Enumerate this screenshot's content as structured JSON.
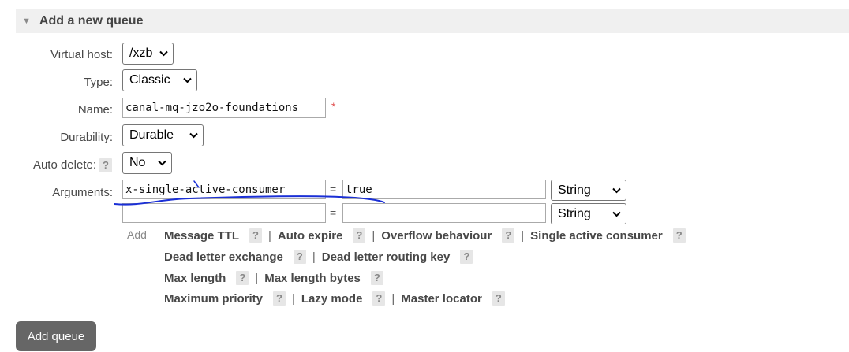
{
  "section": {
    "title": "Add a new queue"
  },
  "fields": {
    "vhost": {
      "label": "Virtual host:",
      "value": "/xzb"
    },
    "type": {
      "label": "Type:",
      "value": "Classic"
    },
    "name": {
      "label": "Name:",
      "value": "canal-mq-jzo2o-foundations",
      "required_mark": "*"
    },
    "durability": {
      "label": "Durability:",
      "value": "Durable"
    },
    "auto_delete": {
      "label": "Auto delete:",
      "help": "?",
      "value": "No"
    },
    "arguments": {
      "label": "Arguments:",
      "rows": [
        {
          "key": "x-single-active-consumer",
          "eq": "=",
          "value": "true",
          "type": "String"
        },
        {
          "key": "",
          "eq": "=",
          "value": "",
          "type": "String"
        }
      ]
    }
  },
  "add_label": "Add",
  "argument_links": [
    [
      "Message TTL",
      "Auto expire",
      "Overflow behaviour",
      "Single active consumer"
    ],
    [
      "Dead letter exchange",
      "Dead letter routing key"
    ],
    [
      "Max length",
      "Max length bytes"
    ],
    [
      "Maximum priority",
      "Lazy mode",
      "Master locator"
    ]
  ],
  "help_glyph": "?",
  "separator": "|",
  "button": {
    "label": "Add queue"
  },
  "icons": {
    "triangle": "triangle-down-icon",
    "chevron": "chevron-down-icon"
  },
  "colors": {
    "annotation_ink": "#1a2fd6",
    "button_bg": "#666666",
    "required": "#e05050"
  }
}
